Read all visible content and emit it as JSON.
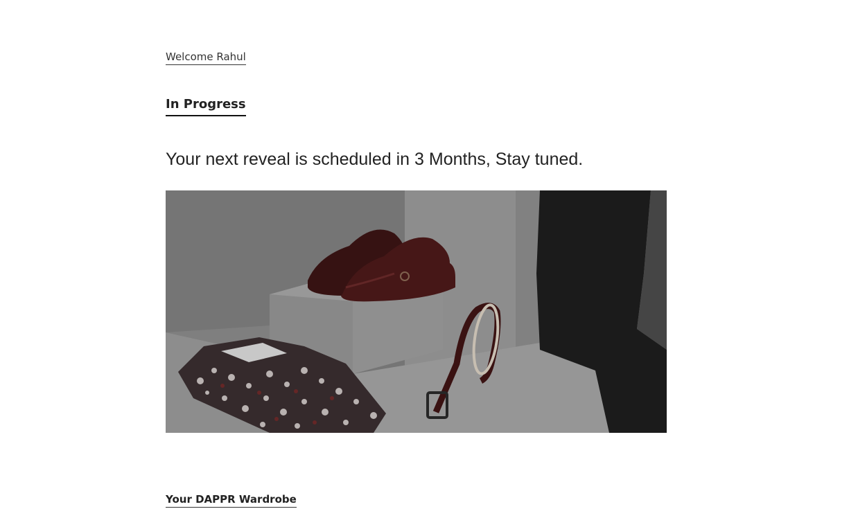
{
  "header": {
    "welcome_text": "Welcome Rahul"
  },
  "status": {
    "title": "In Progress",
    "message": "Your next reveal is scheduled in 3 Months, Stay tuned."
  },
  "footer": {
    "wardrobe_link": "Your DAPPR Wardrobe"
  }
}
